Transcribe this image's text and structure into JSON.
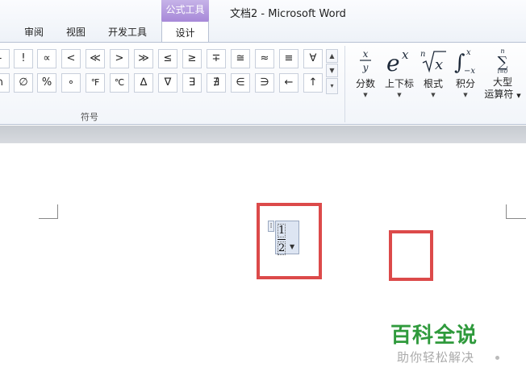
{
  "window": {
    "contextual_group": "公式工具",
    "doc_title": "文档2  -  Microsoft Word"
  },
  "tabs": [
    {
      "label": "审阅"
    },
    {
      "label": "视图"
    },
    {
      "label": "开发工具"
    },
    {
      "label": "设计",
      "active": true
    }
  ],
  "symbols": {
    "row1": [
      "-",
      "!",
      "∝",
      "<",
      "≪",
      ">",
      "≫",
      "≤",
      "≥",
      "∓",
      "≅",
      "≈",
      "≡",
      "∀"
    ],
    "row2": [
      "∩",
      "∅",
      "%",
      "∘",
      "℉",
      "℃",
      "∆",
      "∇",
      "∃",
      "∄",
      "∈",
      "∋",
      "←",
      "↑"
    ],
    "group_label": "符号"
  },
  "structures": [
    {
      "label": "分数",
      "icon": "fraction-icon"
    },
    {
      "label": "上下标",
      "icon": "script-icon"
    },
    {
      "label": "根式",
      "icon": "radical-icon"
    },
    {
      "label": "积分",
      "icon": "integral-icon"
    },
    {
      "label": "大型\n运算符",
      "label1": "大型",
      "label2": "运算符",
      "icon": "large-operator-icon"
    }
  ],
  "equation": {
    "numerator": "1",
    "denominator": "2"
  },
  "watermark": {
    "title": "百科全说",
    "subtitle": "助你轻松解决"
  },
  "colors": {
    "accent_purple": "#a98bd9",
    "highlight_red": "#dc4a4a",
    "watermark_green": "#2f9a3c"
  }
}
